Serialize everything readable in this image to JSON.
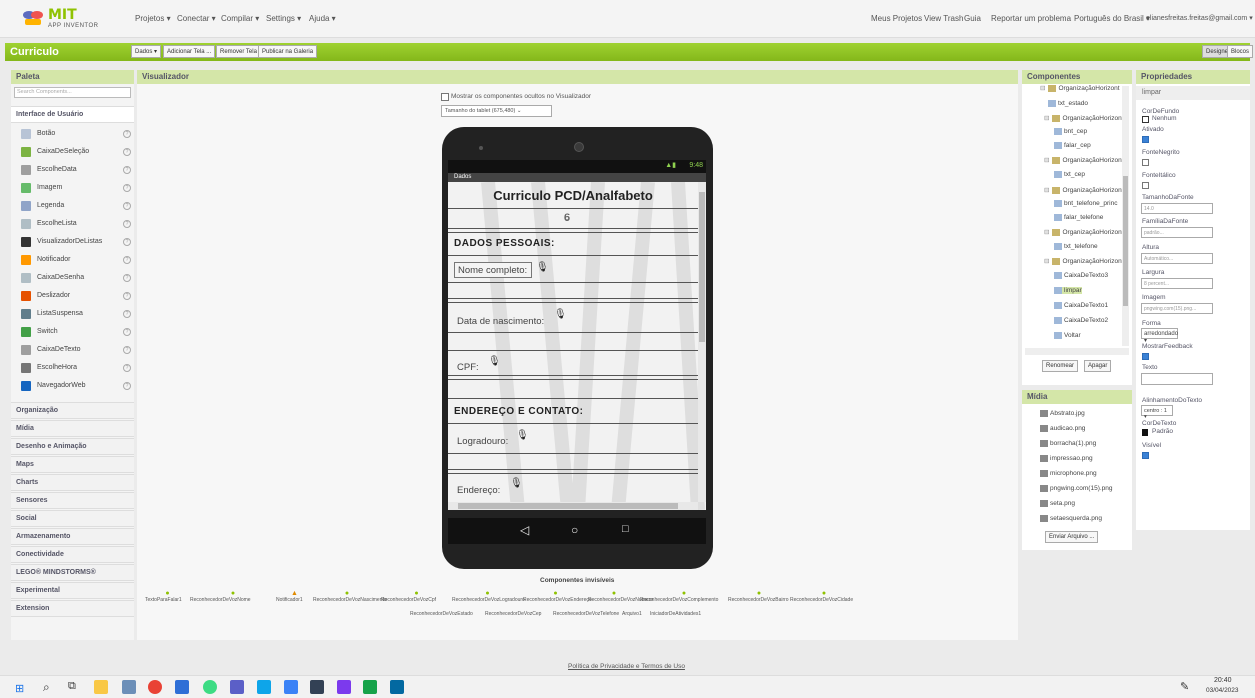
{
  "app": {
    "logo_main": "MIT",
    "logo_sub": "APP INVENTOR",
    "project_title": "Curriculo"
  },
  "topnav": {
    "left": [
      "Projetos ▾",
      "Conectar ▾",
      "Compilar ▾",
      "Settings ▾",
      "Ajuda ▾"
    ],
    "right": [
      "Meus Projetos",
      "View Trash",
      "Guia",
      "Reportar um problema",
      "Português do Brasil ▾",
      "elianesfreitas.freitas@gmail.com ▾"
    ]
  },
  "toolbar": {
    "buttons": [
      "Dados ▾",
      "Adicionar Tela ...",
      "Remover Tela",
      "Publicar na Galeria"
    ],
    "designer": "Designer",
    "blocks": "Blocos"
  },
  "palette": {
    "title": "Paleta",
    "search_placeholder": "Search Components...",
    "category_open": "Interface de Usuário",
    "items": [
      {
        "label": "Botão",
        "color": "#b8c4d6"
      },
      {
        "label": "CaixaDeSeleção",
        "color": "#7cb342"
      },
      {
        "label": "EscolheData",
        "color": "#9e9e9e"
      },
      {
        "label": "Imagem",
        "color": "#66bb6a"
      },
      {
        "label": "Legenda",
        "color": "#90a4c8"
      },
      {
        "label": "EscolheLista",
        "color": "#b0bec5"
      },
      {
        "label": "VisualizadorDeListas",
        "color": "#333333"
      },
      {
        "label": "Notificador",
        "color": "#ff9800"
      },
      {
        "label": "CaixaDeSenha",
        "color": "#b0bec5"
      },
      {
        "label": "Deslizador",
        "color": "#e65100"
      },
      {
        "label": "ListaSuspensa",
        "color": "#607d8b"
      },
      {
        "label": "Switch",
        "color": "#43a047"
      },
      {
        "label": "CaixaDeTexto",
        "color": "#9e9e9e"
      },
      {
        "label": "EscolheHora",
        "color": "#757575"
      },
      {
        "label": "NavegadorWeb",
        "color": "#1565c0"
      }
    ],
    "categories": [
      "Organização",
      "Mídia",
      "Desenho e Animação",
      "Maps",
      "Charts",
      "Sensores",
      "Social",
      "Armazenamento",
      "Conectividade",
      "LEGO® MINDSTORMS®",
      "Experimental",
      "Extension"
    ]
  },
  "viewer": {
    "title": "Visualizador",
    "hidden_checkbox": "Mostrar os componentes ocultos no Visualizador",
    "size_select": "Tamanho do tablet (675,480)",
    "status_time": "9:48",
    "screen_title": "Dados",
    "app_title": "Curriculo PCD/Analfabeto",
    "section1": "DADOS PESSOAIS:",
    "field_nome": "Nome completo:",
    "field_data": "Data de nascimento:",
    "field_cpf": "CPF:",
    "section2": "ENDEREÇO E CONTATO:",
    "field_logradouro": "Logradouro:",
    "field_endereco": "Endereço:",
    "invisible_title": "Componentes invisíveis",
    "invisible_row1": [
      "TextoParaFalar1",
      "ReconhecedorDeVozNome",
      "Notificador1",
      "ReconhecedorDeVozNascimento",
      "ReconhecedorDeVozCpf",
      "ReconhecedorDeVozLogradouro",
      "ReconhecedorDeVozEndereço",
      "ReconhecedorDeVozNumero",
      "ReconhecedorDeVozComplemento",
      "ReconhecedorDeVozBairro",
      "ReconhecedorDeVozCidade"
    ],
    "invisible_row2": [
      "ReconhecedorDeVozEstado",
      "ReconhecedorDeVozCep",
      "ReconhecedorDeVozTelefone",
      "Arquivo1",
      "IniciadorDeAtividades1"
    ]
  },
  "components": {
    "title": "Componentes",
    "tree": [
      "OrganizaçãoHorizont",
      "txt_estado",
      "OrganizaçãoHorizont",
      "bnt_cep",
      "falar_cep",
      "OrganizaçãoHorizont",
      "txt_cep",
      "OrganizaçãoHorizont",
      "bnt_telefone_princ",
      "falar_telefone",
      "OrganizaçãoHorizont",
      "txt_telefone",
      "OrganizaçãoHorizont",
      "CaixaDeTexto3",
      "limpar",
      "CaixaDeTexto1",
      "CaixaDeTexto2",
      "Voltar"
    ],
    "rename": "Renomear",
    "delete": "Apagar"
  },
  "media": {
    "title": "Mídia",
    "files": [
      "Abstrato.jpg",
      "audicao.png",
      "borracha(1).png",
      "impressao.png",
      "microphone.png",
      "pngwing.com(15).png",
      "seta.png",
      "setaesquerda.png"
    ],
    "upload": "Enviar Arquivo ..."
  },
  "properties": {
    "title": "Propriedades",
    "component": "limpar",
    "cor_fundo_label": "CorDeFundo",
    "cor_fundo_value": "Nenhum",
    "ativado_label": "Ativado",
    "negrito_label": "FonteNegrito",
    "italico_label": "FonteItálico",
    "tamanho_label": "TamanhoDaFonte",
    "tamanho_value": "14.0",
    "familia_label": "FamíliaDaFonte",
    "familia_value": "padrão...",
    "altura_label": "Altura",
    "altura_value": "Automático...",
    "largura_label": "Largura",
    "largura_value": "8 percent...",
    "imagem_label": "Imagem",
    "imagem_value": "pngwing.com(15).png...",
    "forma_label": "Forma",
    "forma_value": "arredondado ▾",
    "feedback_label": "MostrarFeedback",
    "texto_label": "Texto",
    "alinhamento_label": "AlinhamentoDoTexto",
    "alinhamento_value": "centro : 1 ▾",
    "cor_texto_label": "CorDeTexto",
    "cor_texto_value": "Padrão",
    "visivel_label": "Visível"
  },
  "footer": {
    "privacy": "Política de Privacidade e Termos de Uso"
  },
  "taskbar": {
    "time": "20:40",
    "date": "03/04/2023"
  }
}
